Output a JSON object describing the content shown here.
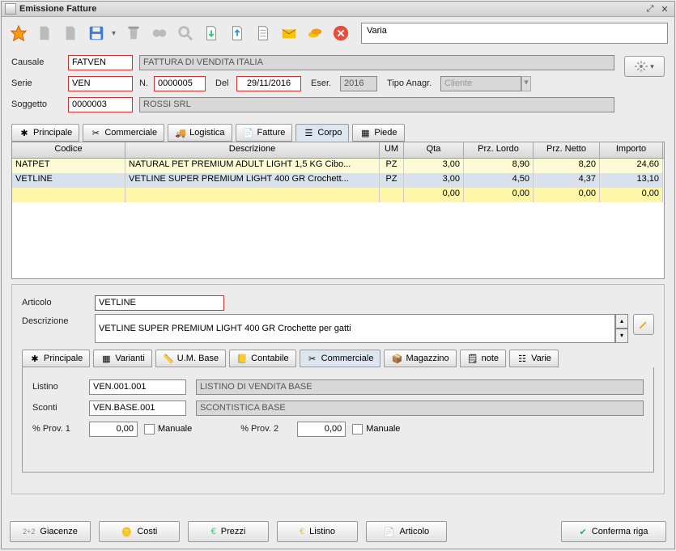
{
  "window": {
    "title": "Emissione Fatture"
  },
  "topInput": "Varia",
  "header": {
    "causale_label": "Causale",
    "causale": "FATVEN",
    "causale_desc": "FATTURA DI VENDITA ITALIA",
    "serie_label": "Serie",
    "serie": "VEN",
    "n_label": "N.",
    "n": "0000005",
    "del_label": "Del",
    "del": "29/11/2016",
    "eser_label": "Eser.",
    "eser": "2016",
    "tipo_label": "Tipo Anagr.",
    "tipo": "Cliente",
    "soggetto_label": "Soggetto",
    "soggetto": "0000003",
    "soggetto_desc": "ROSSI SRL"
  },
  "tabs": {
    "principale": "Principale",
    "commerciale": "Commerciale",
    "logistica": "Logistica",
    "fatture": "Fatture",
    "corpo": "Corpo",
    "piede": "Piede"
  },
  "grid": {
    "cols": [
      "Codice",
      "Descrizione",
      "UM",
      "Qta",
      "Prz. Lordo",
      "Prz. Netto",
      "Importo"
    ],
    "rows": [
      {
        "cls": "y",
        "codice": "NATPET",
        "desc": "NATURAL PET PREMIUM ADULT LIGHT 1,5 KG Cibo...",
        "um": "PZ",
        "qta": "3,00",
        "lordo": "8,90",
        "netto": "8,20",
        "imp": "24,60"
      },
      {
        "cls": "b",
        "codice": "VETLINE",
        "desc": "VETLINE SUPER PREMIUM LIGHT 400 GR Crochett...",
        "um": "PZ",
        "qta": "3,00",
        "lordo": "4,50",
        "netto": "4,37",
        "imp": "13,10"
      },
      {
        "cls": "sel",
        "codice": "",
        "desc": "",
        "um": "",
        "qta": "0,00",
        "lordo": "0,00",
        "netto": "0,00",
        "imp": "0,00"
      }
    ]
  },
  "detail": {
    "articolo_label": "Articolo",
    "articolo": "VETLINE",
    "descrizione_label": "Descrizione",
    "descrizione": "VETLINE SUPER PREMIUM LIGHT 400 GR Crochette per gatti",
    "tabs": {
      "principale": "Principale",
      "varianti": "Varianti",
      "um": "U.M. Base",
      "contabile": "Contabile",
      "commerciale": "Commerciale",
      "magazzino": "Magazzino",
      "note": "note",
      "varie": "Varie"
    },
    "listino_label": "Listino",
    "listino": "VEN.001.001",
    "listino_desc": "LISTINO DI VENDITA BASE",
    "sconti_label": "Sconti",
    "sconti": "VEN.BASE.001",
    "sconti_desc": "SCONTISTICA BASE",
    "prov1_label": "% Prov. 1",
    "prov1": "0,00",
    "manuale1": "Manuale",
    "prov2_label": "% Prov. 2",
    "prov2": "0,00",
    "manuale2": "Manuale"
  },
  "buttons": {
    "giacenze": "Giacenze",
    "costi": "Costi",
    "prezzi": "Prezzi",
    "listino": "Listino",
    "articolo": "Articolo",
    "conferma": "Conferma riga"
  }
}
